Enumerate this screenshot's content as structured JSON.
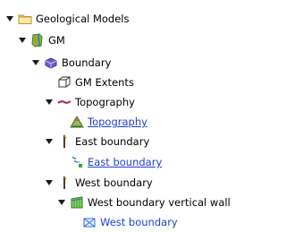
{
  "tree": {
    "geological_models": {
      "label": "Geological Models"
    },
    "gm": {
      "label": "GM"
    },
    "boundary": {
      "label": "Boundary"
    },
    "gm_extents": {
      "label": "GM Extents"
    },
    "topography_group": {
      "label": "Topography"
    },
    "topography_link": {
      "label": "Topography"
    },
    "east_boundary_group": {
      "label": "East boundary"
    },
    "east_boundary_link": {
      "label": "East boundary"
    },
    "west_boundary_group": {
      "label": "West boundary"
    },
    "west_wall": {
      "label": "West boundary vertical wall"
    },
    "west_boundary_link": {
      "label": "West boundary"
    }
  },
  "colors": {
    "link": "#1f3fd1",
    "folder": "#f2d36b",
    "gm_icon": "#7fbf3f",
    "boundary_icon": "#6b5fd0"
  }
}
